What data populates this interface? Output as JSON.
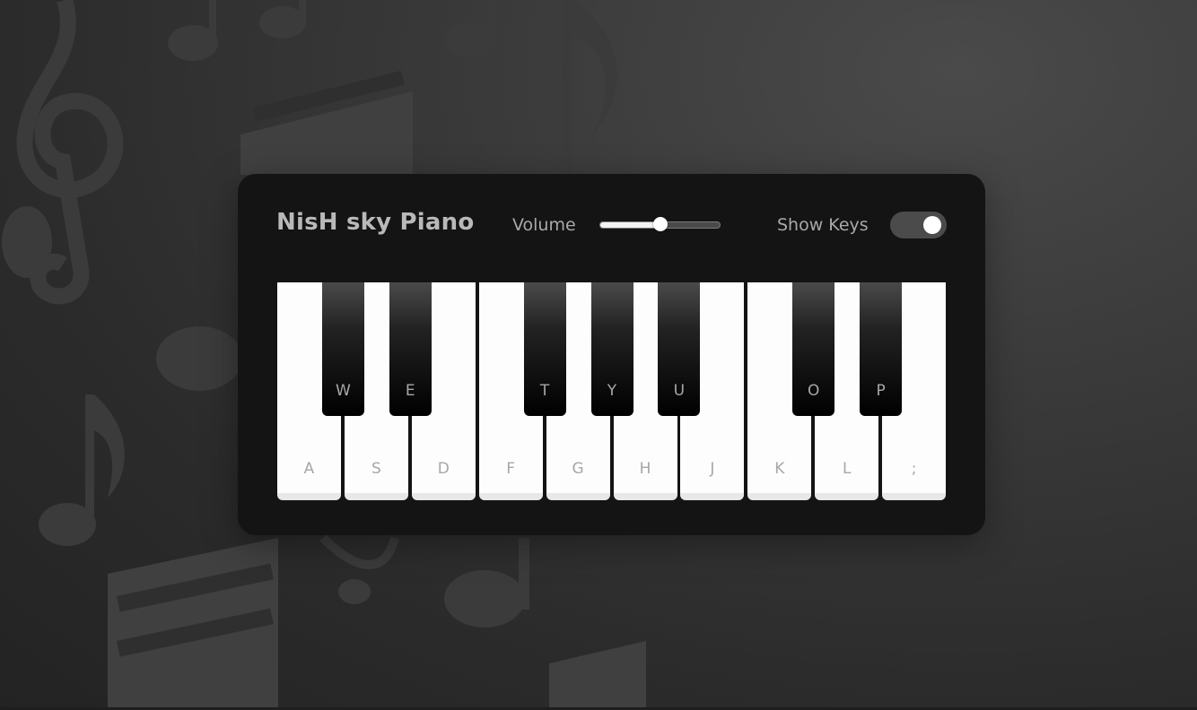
{
  "app": {
    "title": "NisH sky Piano"
  },
  "controls": {
    "volume_label": "Volume",
    "volume_value": 0.5,
    "show_keys_label": "Show Keys",
    "show_keys_on": true
  },
  "keyboard": {
    "white_keys": [
      "A",
      "S",
      "D",
      "F",
      "G",
      "H",
      "J",
      "K",
      "L",
      ";"
    ],
    "black_keys": [
      "W",
      "E",
      "T",
      "Y",
      "U",
      "O",
      "P"
    ]
  },
  "colors": {
    "panel": "#141414",
    "white_key": "#fdfdfd",
    "black_key": "#000000",
    "key_label": "#a7a7a7",
    "accent": "#ffffff"
  },
  "background": {
    "decorations": [
      "treble-clef-icon",
      "music-note-icon",
      "beamed-notes-icon"
    ]
  }
}
